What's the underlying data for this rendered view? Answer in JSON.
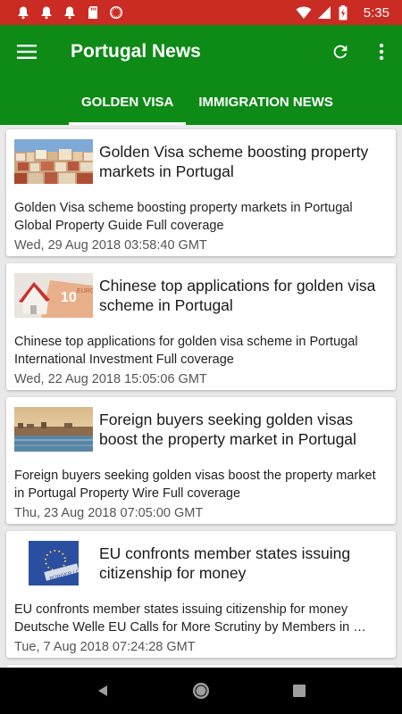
{
  "status": {
    "time": "5:35",
    "icons": [
      "alarm-bell-icon",
      "alarm-bell-icon",
      "alarm-bell-icon",
      "sd-card-icon",
      "record-icon",
      "wifi-icon",
      "signal-icon",
      "battery-charging-icon"
    ]
  },
  "appbar": {
    "title": "Portugal News",
    "menu_icon": "hamburger-menu-icon",
    "refresh_icon": "refresh-icon",
    "overflow_icon": "more-vert-icon"
  },
  "tabs": [
    {
      "label": "GOLDEN VISA",
      "active": true
    },
    {
      "label": "IMMIGRATION NEWS",
      "active": false
    }
  ],
  "articles": [
    {
      "title": "Golden Visa scheme boosting property markets in Portugal",
      "summary": "Golden Visa scheme boosting property markets in Portugal",
      "source_line": "Global Property Guide  Full coverage",
      "date": "Wed, 29 Aug 2018 03:58:40 GMT",
      "thumb": "town-cityscape-thumbnail"
    },
    {
      "title": "Chinese top applications for golden visa scheme in Portugal",
      "summary": "Chinese top applications for golden visa scheme in Portugal",
      "source_line": "International Investment  Full coverage",
      "date": "Wed, 22 Aug 2018 15:05:06 GMT",
      "thumb": "house-on-euro-note-thumbnail"
    },
    {
      "title": "Foreign buyers seeking golden visas boost the property market in Portugal",
      "summary": "Foreign buyers seeking golden visas boost the property market in Portugal  Property Wire  Full coverage",
      "source_line": "",
      "date": "Thu, 23 Aug 2018 07:05:00 GMT",
      "thumb": "river-city-sunset-thumbnail"
    },
    {
      "title": "EU confronts member states issuing citizenship for money",
      "summary": "EU confronts member states issuing citizenship for money",
      "source_line": "Deutsche Welle  EU Calls for More Scrutiny by Members in …",
      "date": "Tue, 7 Aug 2018 07:24:28 GMT",
      "thumb": "eu-passport-thumbnail"
    }
  ],
  "navbar": {
    "back_icon": "back-triangle-icon",
    "home_icon": "home-circle-icon",
    "recents_icon": "recents-square-icon"
  }
}
